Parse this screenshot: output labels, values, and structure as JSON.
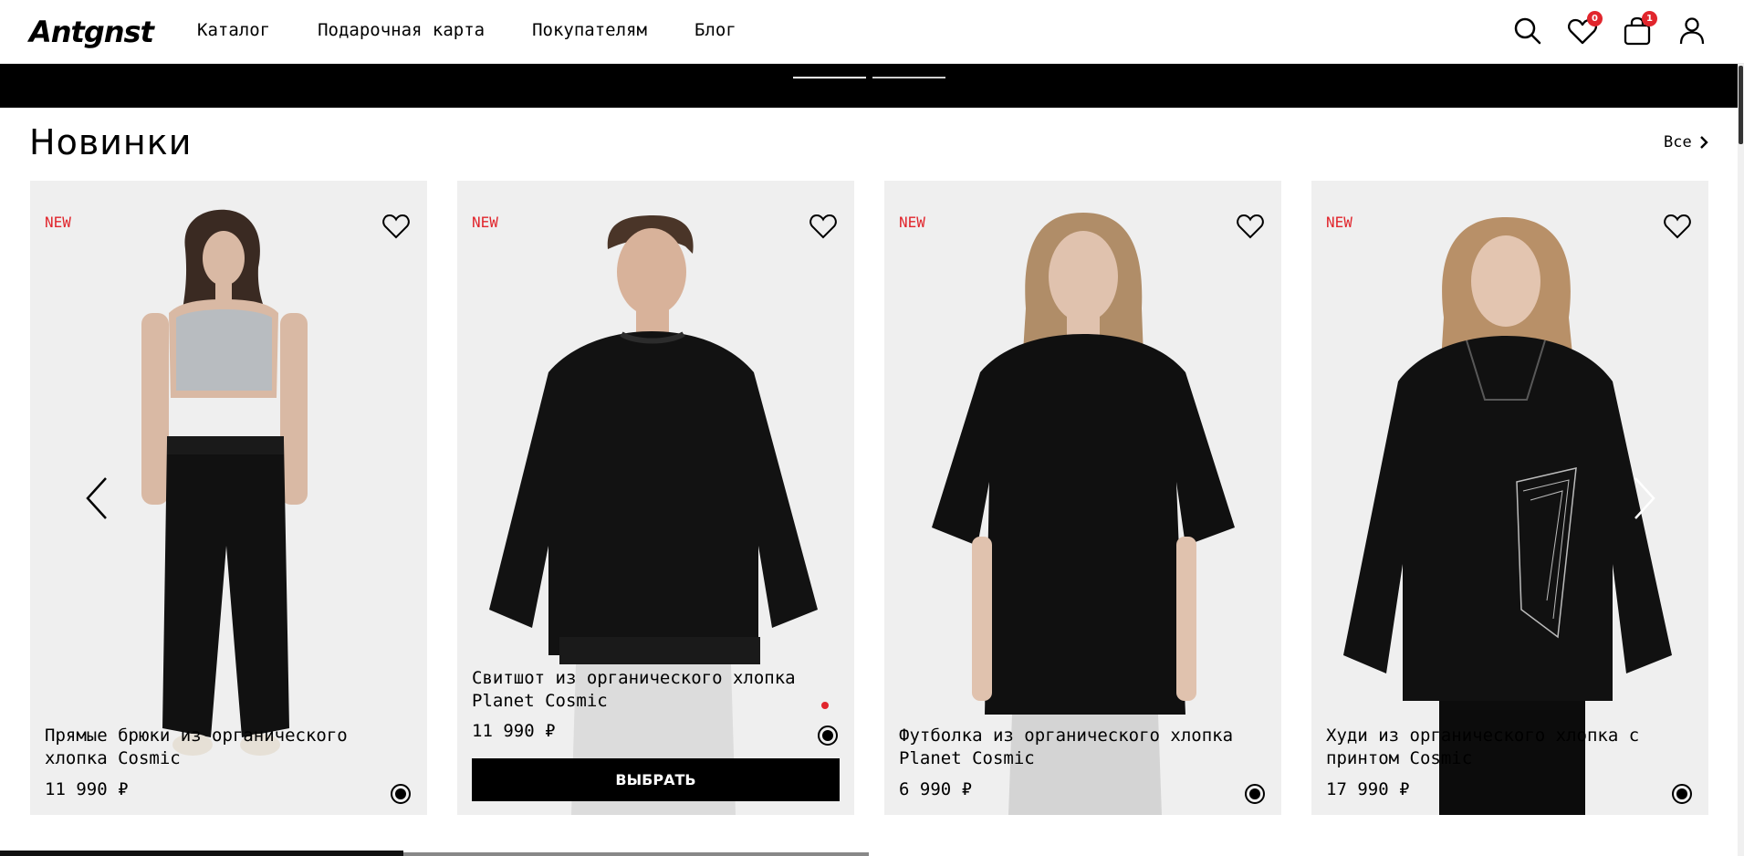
{
  "header": {
    "logo": "Antgnst",
    "nav": [
      "Каталог",
      "Подарочная карта",
      "Покупателям",
      "Блог"
    ],
    "favorites_count": "0",
    "cart_count": "1"
  },
  "section": {
    "title": "Новинки",
    "all_link": "Все"
  },
  "products": [
    {
      "badge": "NEW",
      "title": "Прямые брюки из органического хлопка Cosmic",
      "price": "11 990 ₽"
    },
    {
      "badge": "NEW",
      "title": "Свитшот из органического хлопка Planet Cosmic",
      "price": "11 990 ₽",
      "button": "ВЫБРАТЬ"
    },
    {
      "badge": "NEW",
      "title": "Футболка из органического хлопка Planet Cosmic",
      "price": "6 990 ₽"
    },
    {
      "badge": "NEW",
      "title": "Худи из органического хлопка с принтом Cosmic",
      "price": "17 990 ₽"
    }
  ],
  "colors": {
    "accent": "#e1262d",
    "card_bg": "#efefef",
    "black": "#000000"
  }
}
